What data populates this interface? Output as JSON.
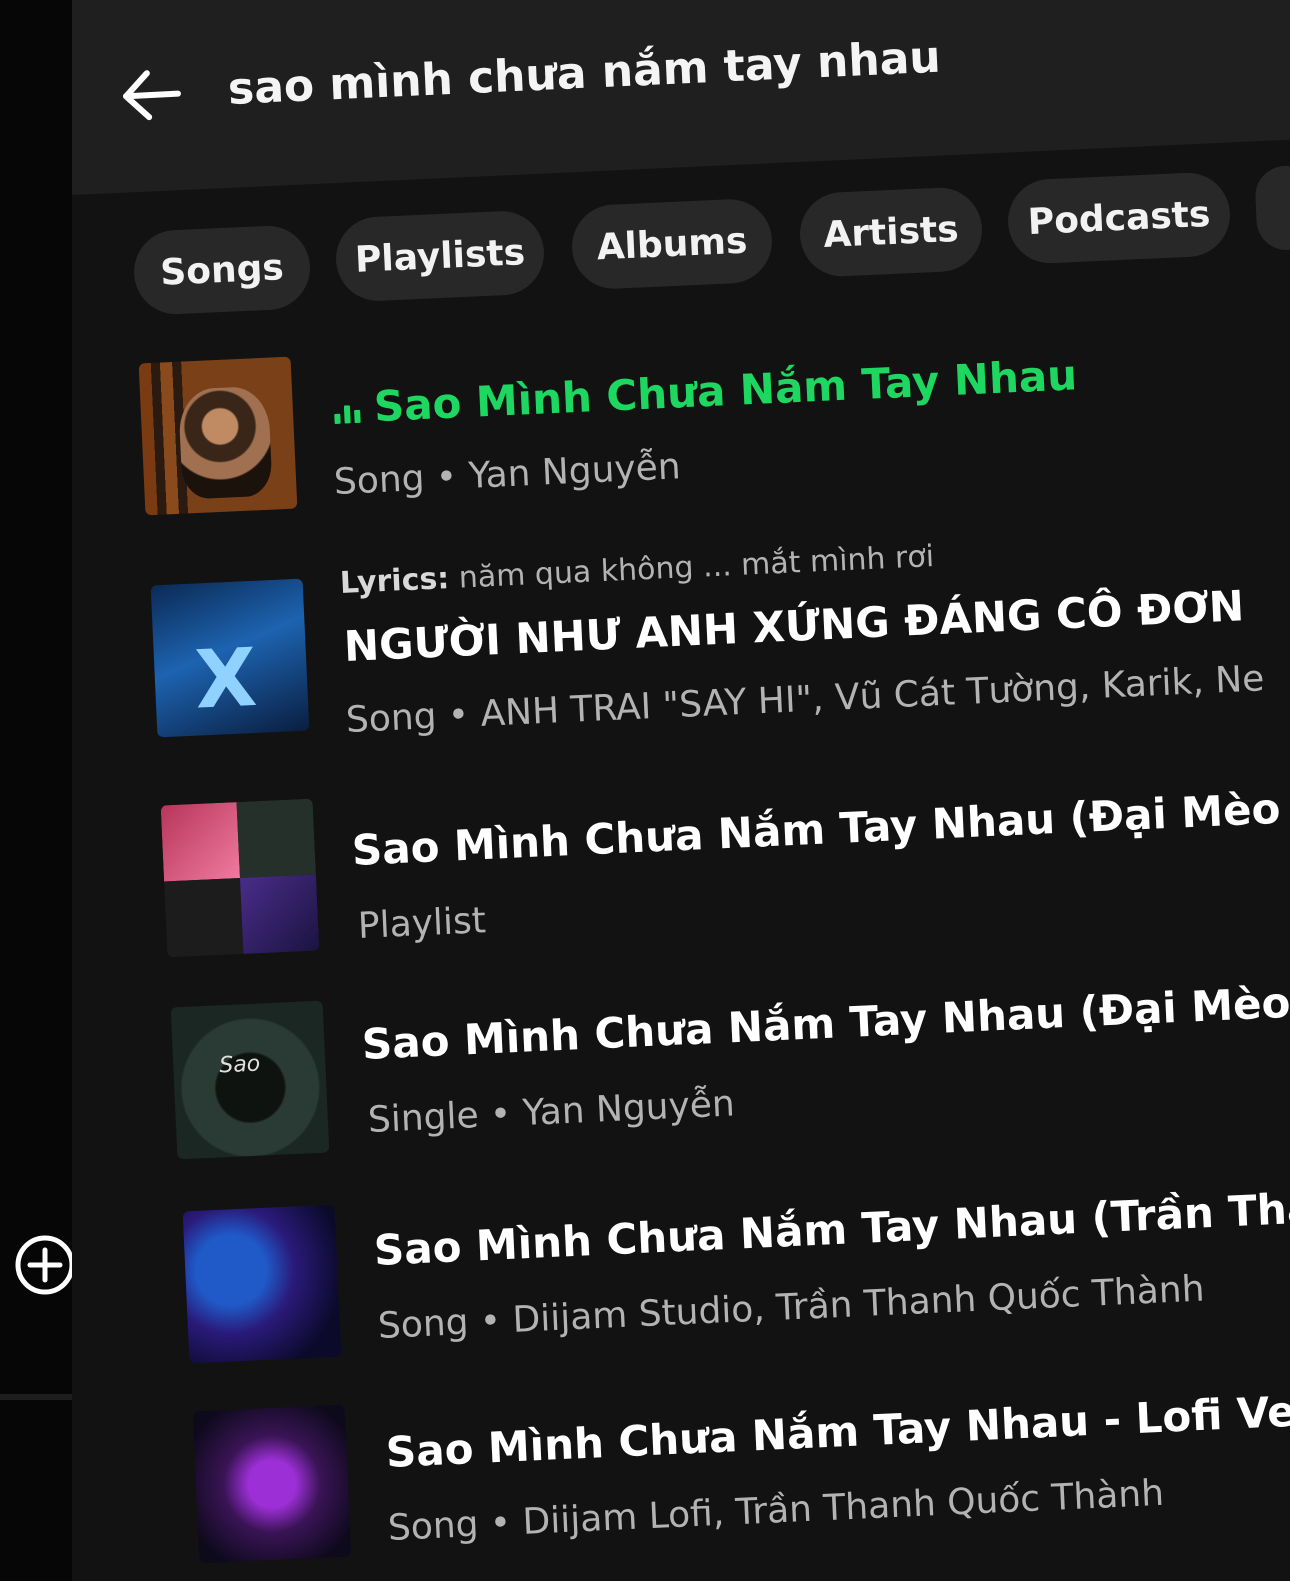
{
  "search": {
    "query": "sao mình chưa nắm tay nhau"
  },
  "filters": [
    {
      "label": "Songs"
    },
    {
      "label": "Playlists"
    },
    {
      "label": "Albums"
    },
    {
      "label": "Artists"
    },
    {
      "label": "Podcasts"
    }
  ],
  "results": [
    {
      "title": "Sao Mình Chưa Nắm Tay Nhau",
      "type": "Song",
      "artist": "Yan Nguyễn",
      "playing": true
    },
    {
      "lyrics_prefix": "Lyrics:",
      "lyrics_text": "năm qua không ... mắt mình rơi",
      "title": "NGƯỜI NHƯ ANH XỨNG ĐÁNG CÔ ĐƠN",
      "type": "Song",
      "artist": "ANH TRAI \"SAY HI\", Vũ Cát Tường, Karik, Ne"
    },
    {
      "title": "Sao Mình Chưa Nắm Tay Nhau (Đại Mèo R",
      "type": "Playlist",
      "artist": ""
    },
    {
      "title": "Sao Mình Chưa Nắm Tay Nhau (Đại Mèo I",
      "type": "Single",
      "artist": "Yan Nguyễn"
    },
    {
      "title": "Sao Mình Chưa Nắm Tay Nhau (Trần Thar",
      "type": "Song",
      "artist": "Diijam Studio, Trần Thanh Quốc Thành"
    },
    {
      "title": "Sao Mình Chưa Nắm Tay Nhau - Lofi Ver",
      "type": "Song",
      "artist": "Diijam Lofi, Trần Thanh Quốc Thành"
    }
  ],
  "separator": "•",
  "colors": {
    "accent": "#1ed760",
    "background": "#121212",
    "chip": "#282828",
    "secondary_text": "#b3b3b3"
  },
  "icons": {
    "back": "arrow-left-icon",
    "add": "plus-circle-icon",
    "playing": "equalizer-icon"
  }
}
